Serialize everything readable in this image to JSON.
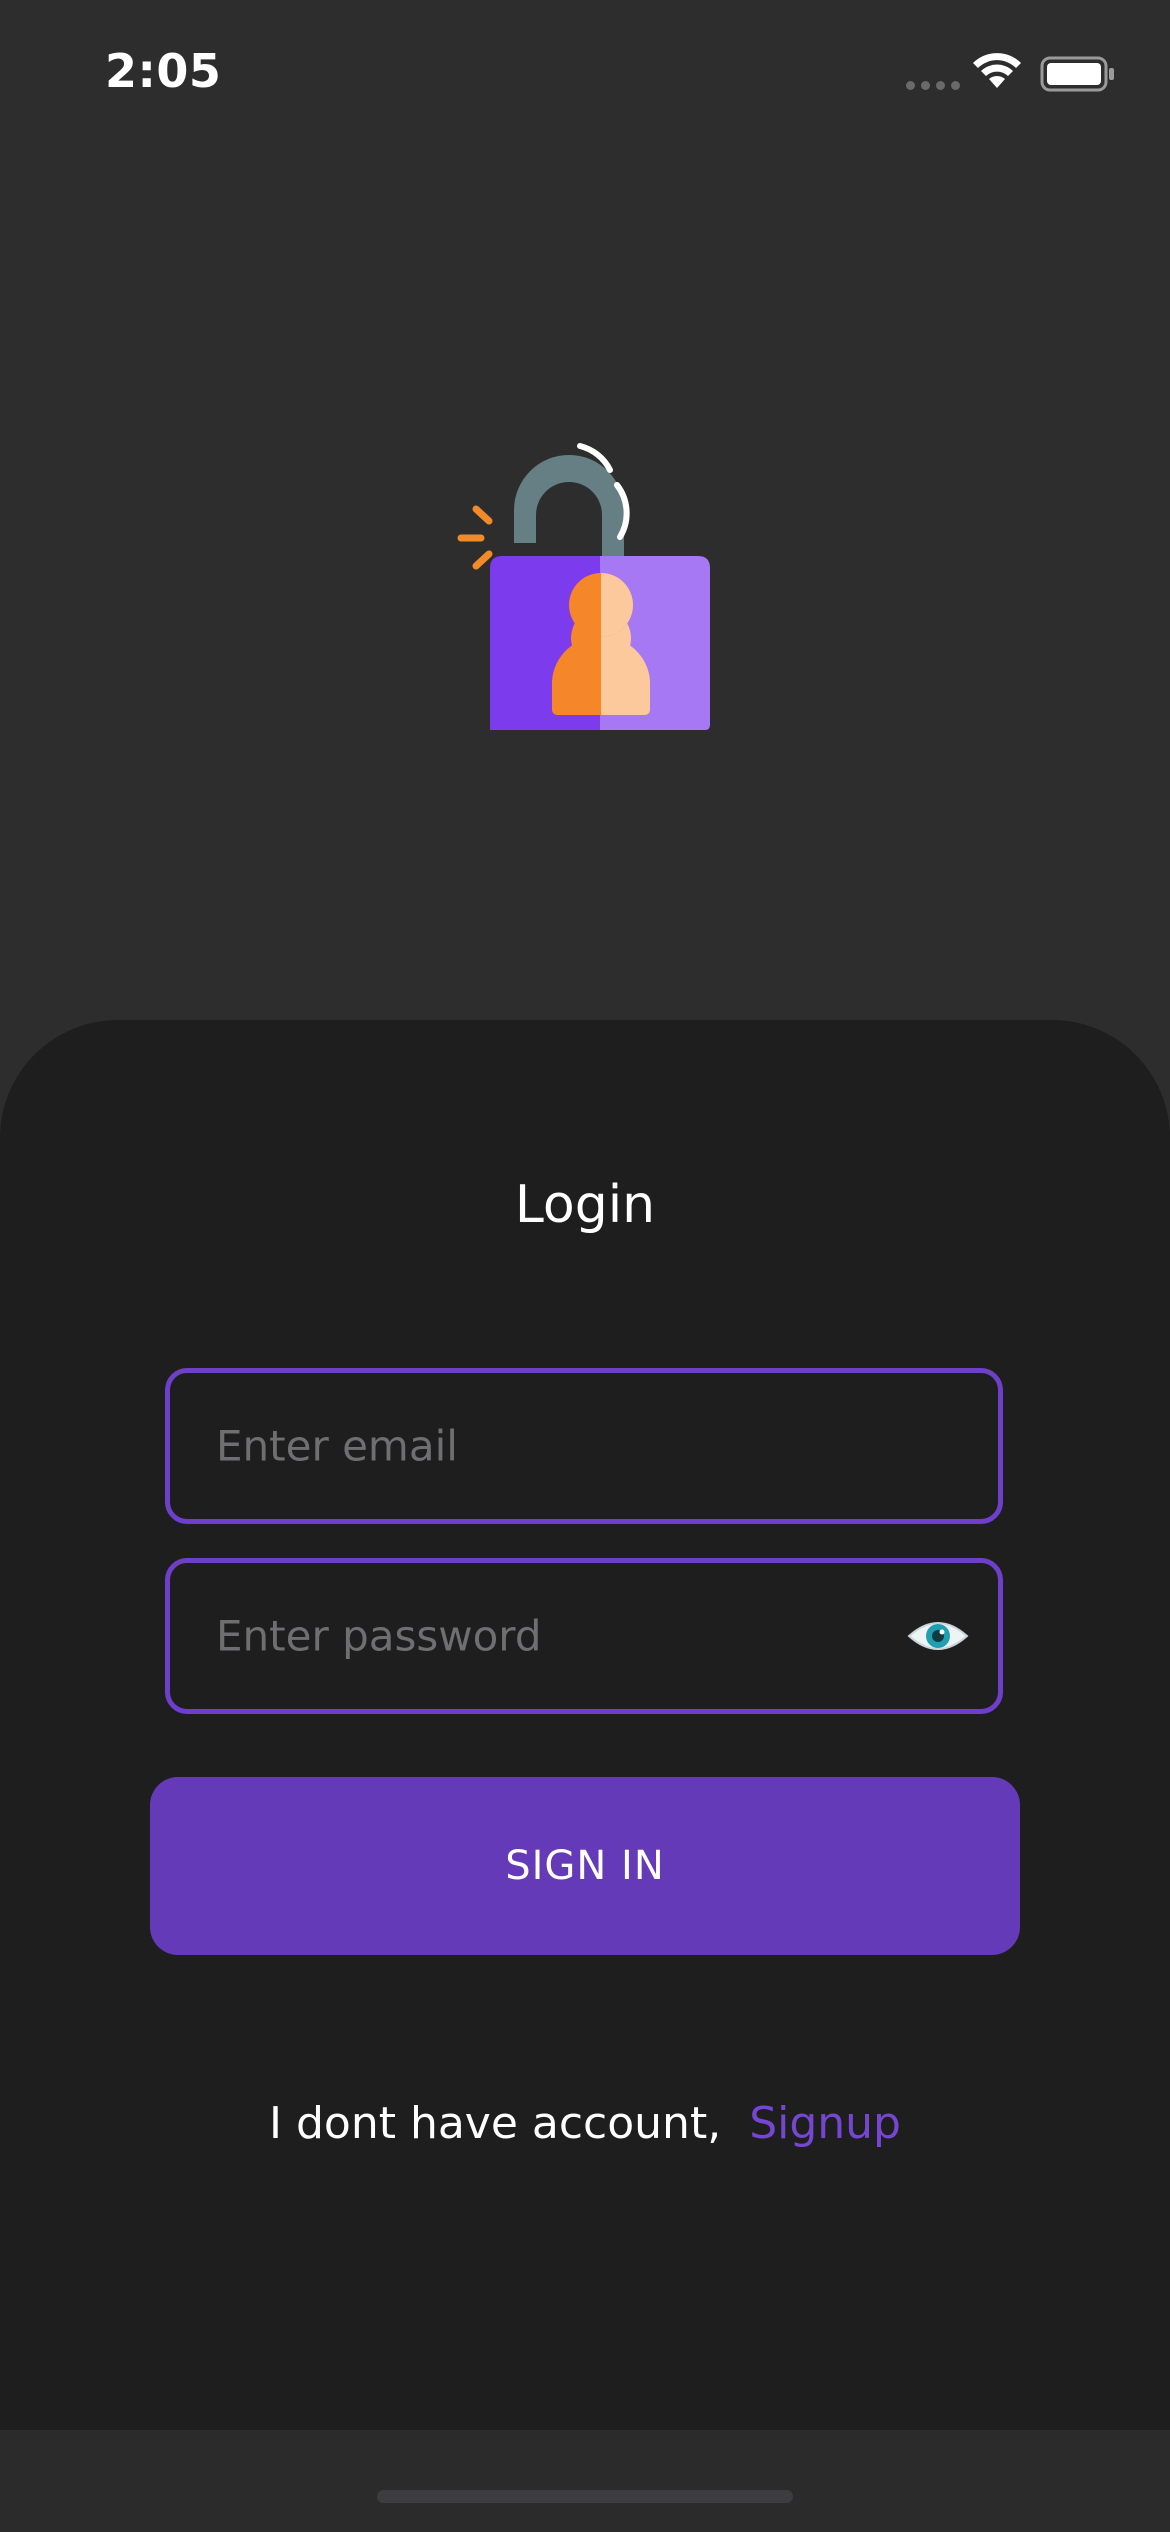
{
  "status_bar": {
    "time": "2:05"
  },
  "login": {
    "title": "Login",
    "email_placeholder": "Enter email",
    "password_placeholder": "Enter password",
    "sign_in_label": "SIGN IN",
    "signup_prompt": "I dont have account,",
    "signup_link": "Signup"
  },
  "colors": {
    "background": "#2d2d2e",
    "sheet": "#1e1e1f",
    "accent": "#653ab8",
    "field_border": "#6e3fc9",
    "link": "#7446d1"
  },
  "icons": {
    "hero": "lock-user-icon",
    "password_toggle": "eye-icon",
    "wifi": "wifi-icon",
    "battery": "battery-icon"
  }
}
